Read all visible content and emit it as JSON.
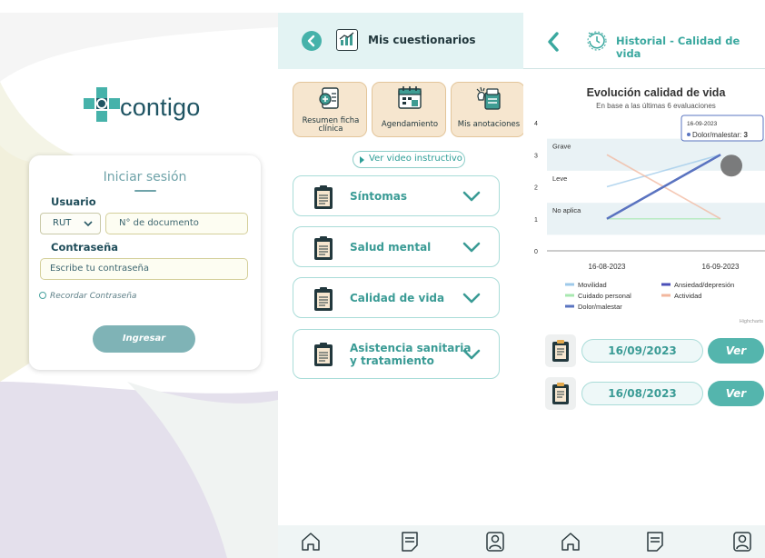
{
  "login": {
    "brand": "contigo",
    "title": "Iniciar sesión",
    "user_label": "Usuario",
    "doc_type": "RUT",
    "doc_placeholder": "N° de documento",
    "password_label": "Contraseña",
    "password_placeholder": "Escribe tu contraseña",
    "remember": "Recordar Contraseña",
    "submit": "Ingresar"
  },
  "questionnaires": {
    "title": "Mis cuestionarios",
    "quick_actions": [
      {
        "label": "Resumen ficha clínica",
        "icon": "clinical-file-icon"
      },
      {
        "label": "Agendamiento",
        "icon": "calendar-icon"
      },
      {
        "label": "Mis anotaciones",
        "icon": "notes-icon"
      }
    ],
    "video": "Ver video instructivo",
    "sections": [
      {
        "label": "Síntomas"
      },
      {
        "label": "Salud mental"
      },
      {
        "label": "Calidad de vida"
      },
      {
        "label": "Asistencia sanitaria y tratamiento"
      }
    ]
  },
  "history": {
    "title": "Historial - Calidad de vida",
    "evaluations": [
      {
        "date": "16/09/2023",
        "action": "Ver"
      },
      {
        "date": "16/08/2023",
        "action": "Ver"
      }
    ]
  },
  "chart_data": {
    "type": "line",
    "title": "Evolución calidad de vida",
    "subtitle": "En base a las últimas 6 evaluaciones",
    "x": [
      "16-08-2023",
      "16-09-2023"
    ],
    "ylim": [
      0,
      4
    ],
    "yticks": [
      0,
      1,
      2,
      3,
      4
    ],
    "bands": [
      {
        "label": "Grave",
        "from": 2.5,
        "to": 3.5
      },
      {
        "label": "Leve",
        "from": 1.5,
        "to": 2.5
      },
      {
        "label": "No aplica",
        "from": 0.5,
        "to": 1.5
      }
    ],
    "series": [
      {
        "name": "Movilidad",
        "color": "#9ec9ea",
        "values": [
          2,
          3
        ]
      },
      {
        "name": "Ansiedad/depresión",
        "color": "#4a4fb8",
        "values": [
          1,
          3
        ]
      },
      {
        "name": "Cuidado personal",
        "color": "#a8e8b0",
        "values": [
          1,
          1
        ]
      },
      {
        "name": "Actividad",
        "color": "#f2b79e",
        "values": [
          3,
          1
        ]
      },
      {
        "name": "Dolor/malestar",
        "color": "#5a74c0",
        "values": [
          1,
          3
        ]
      }
    ],
    "tooltip": {
      "date": "16-09-2023",
      "series": "Dolor/malestar",
      "value": "3"
    },
    "credit": "Highcharts",
    "grid": true,
    "legend": "bottom"
  },
  "colors": {
    "teal": "#46b2aa",
    "header_bg": "#e3f3f3",
    "card_bg": "#f6e6cf"
  }
}
